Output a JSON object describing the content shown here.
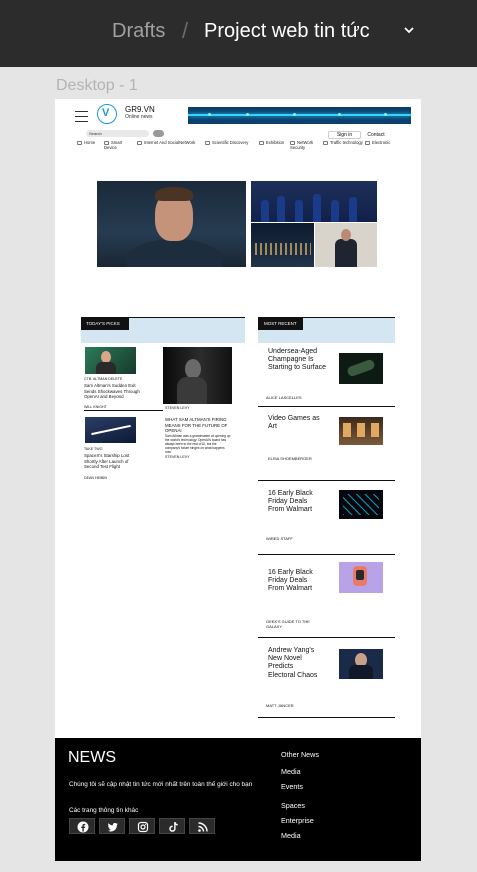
{
  "figma": {
    "breadcrumb_root": "Drafts",
    "breadcrumb_sep": "/",
    "project_title": "Project web tin tức",
    "frame_label": "Desktop - 1"
  },
  "header": {
    "brand": "GR9.VN",
    "brand_sub": "Online news",
    "search_placeholder": "Search",
    "signin": "Sign in",
    "contact": "Contact"
  },
  "nav": [
    {
      "label": "Home"
    },
    {
      "label": "Smart Device"
    },
    {
      "label": "Internet And SocialNetWork"
    },
    {
      "label": "Scientific Discovery"
    },
    {
      "label": "Exhibition"
    },
    {
      "label": "NetWork Security"
    },
    {
      "label": "Traffic technology"
    },
    {
      "label": "Electronic"
    }
  ],
  "picks": {
    "heading": "TODAY'S PICKS",
    "card1_meta": "CTB. ALTMAN DELETE",
    "card1_title": "Sam Altman's Sudden Exit Sends Shockwaves Through OpenAI and Beyond",
    "card1_author": "WILL KNIGHT",
    "card2_meta": "TAKE TWO",
    "card2_title": "SpaceX's Starship Lost Shortly After Launch of Second Test Flight",
    "card2_author": "DEAN HEIBIN",
    "big_meta": "STEVEN LEVY",
    "big_title": "WHAT SAM ALTMAN'S FIRING MEANS FOR THE FUTURE OF OPENAI",
    "big_body": "Sam Altman was a grandmaster at opening up the world's technology. OpenAI's board has always been to the rest of AI, but the company's future hinges on what happens now.",
    "big_footer": "STEVEN LEVY"
  },
  "recent": {
    "heading": "MOST RECENT",
    "items": [
      {
        "title": "Undersea-Aged Champagne Is Starting to Surface",
        "author": "ALICE LASCELLES"
      },
      {
        "title": "Video Games as Art",
        "author": "ELISA SHOEMBERGER"
      },
      {
        "title": "16 Early Black Friday Deals From Walmart",
        "author": "WIRED STAFF"
      },
      {
        "title": "16 Early Black Friday Deals From Walmart",
        "author": "GEEK'S GUIDE TO THE GALAXY"
      },
      {
        "title": "Andrew Yang's New Novel Predicts Electoral Chaos",
        "author": "MATT JANCER"
      }
    ]
  },
  "footer": {
    "title": "NEWS",
    "description": "Chúng tôi sẽ cập nhật tin tức mới nhất trên toàn thế giới cho bạn",
    "other_pages": "Các trang thông tin khác",
    "links": [
      "Other News",
      "Media",
      "Events",
      "Spaces",
      "Enterprise",
      "Media"
    ],
    "social": [
      "facebook-icon",
      "twitter-icon",
      "instagram-icon",
      "tiktok-icon",
      "rss-icon"
    ]
  }
}
